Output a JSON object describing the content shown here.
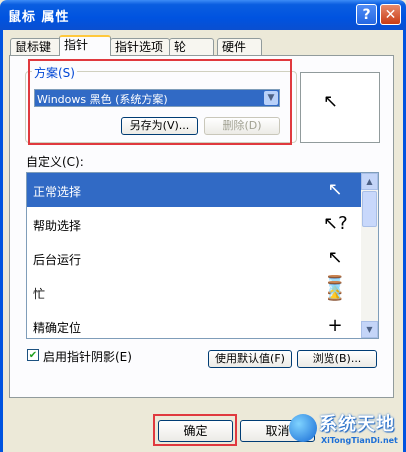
{
  "window": {
    "title": "鼠标 属性",
    "help_glyph": "?",
    "close_glyph": "✕"
  },
  "tabs": [
    {
      "label": "鼠标键"
    },
    {
      "label": "指针"
    },
    {
      "label": "指针选项"
    },
    {
      "label": "轮"
    },
    {
      "label": "硬件"
    }
  ],
  "active_tab": "指针",
  "scheme": {
    "group_label": "方案(S)",
    "selected": "Windows 黑色 (系统方案)",
    "save_as": "另存为(V)...",
    "delete": "删除(D)"
  },
  "custom": {
    "label": "自定义(C):",
    "items": [
      {
        "label": "正常选择",
        "icon": "arrow-pointer-icon",
        "glyph": "↖",
        "selected": true
      },
      {
        "label": "帮助选择",
        "icon": "help-pointer-icon",
        "glyph": "↖?",
        "selected": false
      },
      {
        "label": "后台运行",
        "icon": "working-background-icon",
        "glyph": "↖⌛",
        "selected": false
      },
      {
        "label": "忙",
        "icon": "hourglass-icon",
        "glyph": "⌛",
        "selected": false
      },
      {
        "label": "精确定位",
        "icon": "crosshair-icon",
        "glyph": "+",
        "selected": false
      }
    ]
  },
  "shadow": {
    "label": "启用指针阴影(E)",
    "checked": true
  },
  "buttons": {
    "use_default": "使用默认值(F)",
    "browse": "浏览(B)...",
    "ok": "确定",
    "cancel": "取消"
  },
  "watermark": {
    "brand": "系统天地",
    "sub": "XiTongTianDi.net"
  },
  "colors": {
    "selection": "#316ac5",
    "highlight_box": "#e0393e",
    "titlebar": "#0053e0"
  }
}
